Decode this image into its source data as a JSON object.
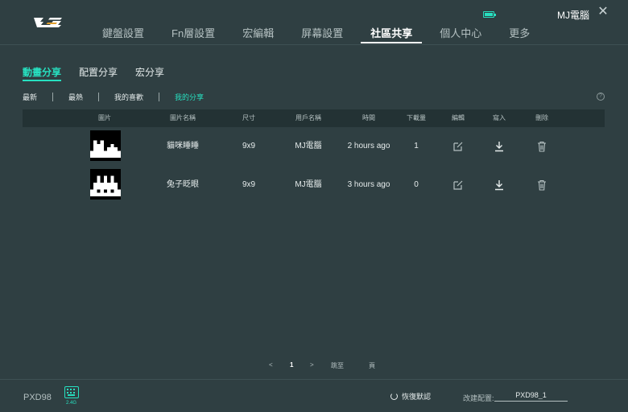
{
  "header": {
    "nav": [
      "鍵盤設置",
      "Fn層設置",
      "宏編輯",
      "屏幕設置",
      "社區共享",
      "個人中心",
      "更多"
    ],
    "active_nav": 4,
    "username": "MJ電腦",
    "close_glyph": "✕",
    "battery_color": "#27e0c0"
  },
  "subtabs": {
    "items": [
      "動畫分享",
      "配置分享",
      "宏分享"
    ],
    "active": 0
  },
  "filters": {
    "items": [
      "最新",
      "最熱",
      "我的喜歡",
      "我的分享"
    ],
    "active": 3,
    "help_glyph": "?"
  },
  "table": {
    "columns": [
      "圖片",
      "圖片名稱",
      "尺寸",
      "用戶名稱",
      "時間",
      "下載量",
      "編輯",
      "寫入",
      "刪除"
    ],
    "rows": [
      {
        "name": "貓咪睡睡",
        "size": "9x9",
        "user": "MJ電腦",
        "time": "2 hours ago",
        "downloads": "1",
        "thumb_icon": "cat-sleeping-pixel-icon"
      },
      {
        "name": "兔子眨眼",
        "size": "9x9",
        "user": "MJ電腦",
        "time": "3 hours ago",
        "downloads": "0",
        "thumb_icon": "rabbit-blink-pixel-icon"
      }
    ]
  },
  "pagination": {
    "prev": "<",
    "current": "1",
    "next": ">",
    "jump_label": "跳至",
    "page_label": "頁"
  },
  "footer": {
    "model": "PXD98",
    "connection": "2.4G",
    "restore_label": "恢復默認",
    "config_label": "改建配置:",
    "config_value": "PXD98_1"
  },
  "colors": {
    "accent": "#27e0c0",
    "background": "#2f3f42",
    "table_header": "#233234"
  }
}
